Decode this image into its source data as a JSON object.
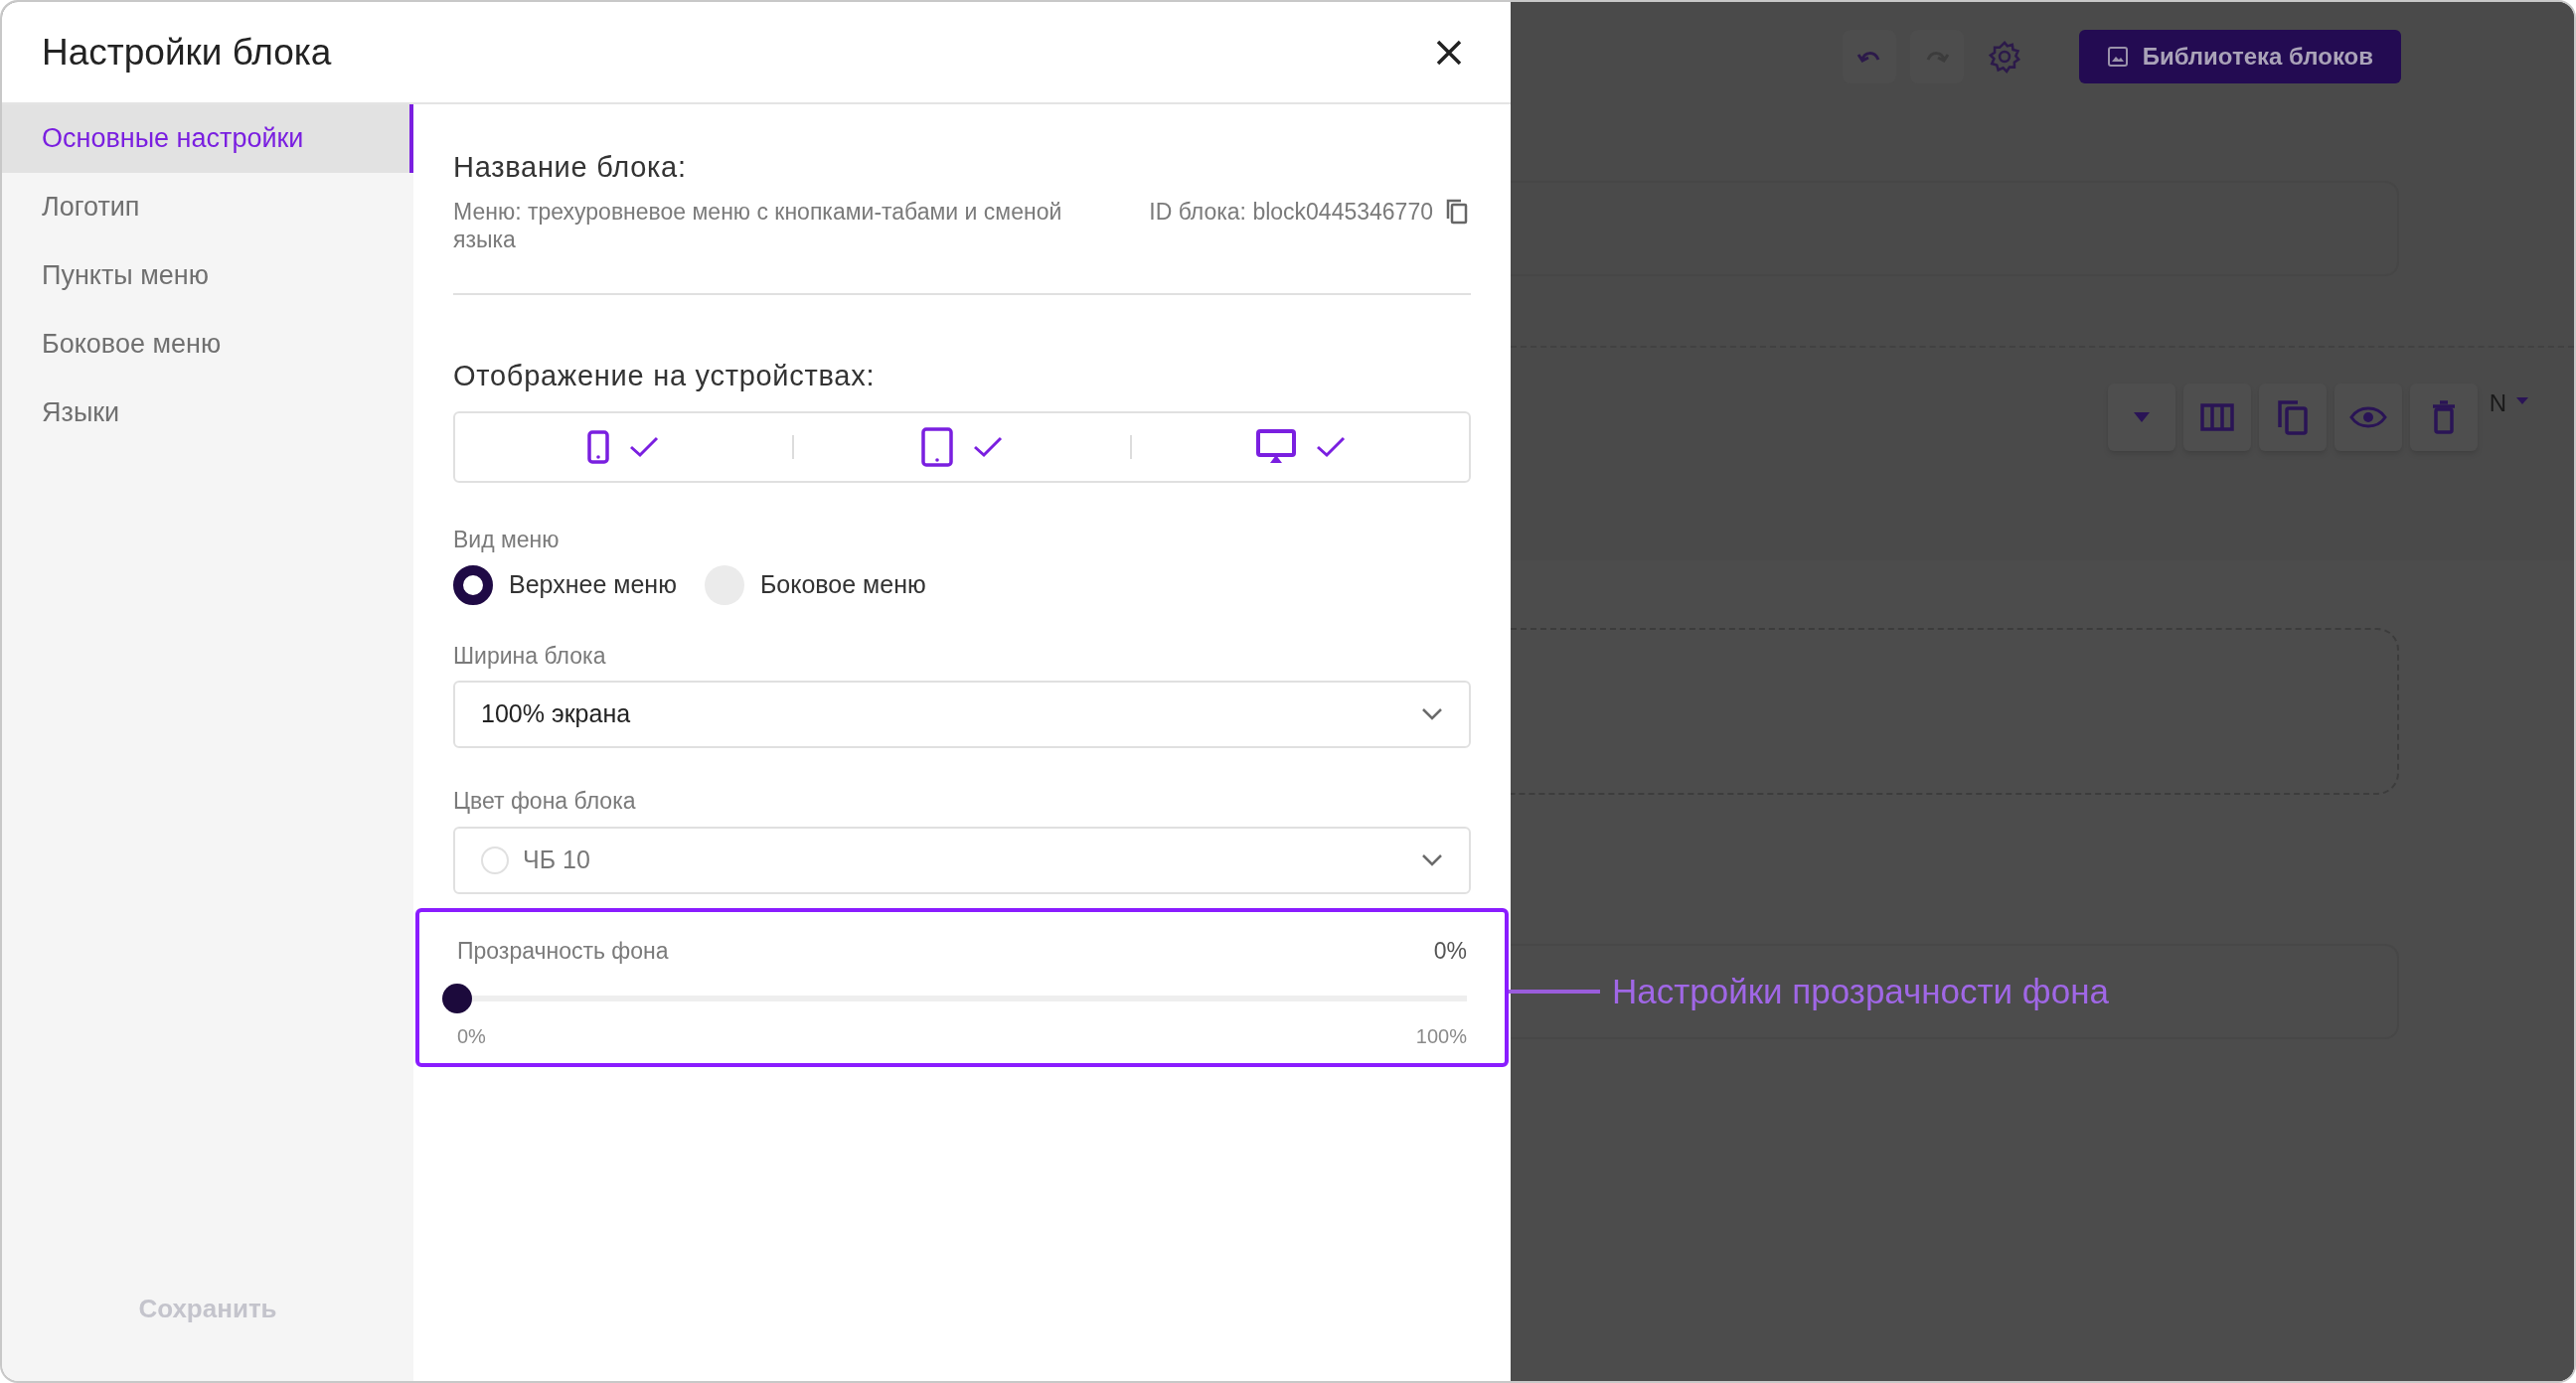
{
  "dialog": {
    "title": "Настройки блока",
    "sidebar": {
      "items": [
        {
          "label": "Основные настройки",
          "selected": true
        },
        {
          "label": "Логотип",
          "selected": false
        },
        {
          "label": "Пункты меню",
          "selected": false
        },
        {
          "label": "Боковое меню",
          "selected": false
        },
        {
          "label": "Языки",
          "selected": false
        }
      ],
      "save_button": {
        "label": "Сохранить",
        "disabled": true
      }
    },
    "block_name": {
      "heading": "Название блока:",
      "description": "Меню: трехуровневое меню с кнопками-табами и сменой языка",
      "id_text": "ID блока: block0445346770"
    },
    "devices": {
      "heading": "Отображение на устройствах:",
      "items": [
        {
          "kind": "phone",
          "checked": true
        },
        {
          "kind": "tablet",
          "checked": true
        },
        {
          "kind": "desktop",
          "checked": true
        }
      ]
    },
    "menu_type": {
      "label": "Вид меню",
      "options": [
        {
          "label": "Верхнее меню",
          "selected": true
        },
        {
          "label": "Боковое меню",
          "selected": false
        }
      ]
    },
    "block_width": {
      "label": "Ширина блока",
      "value": "100% экрана"
    },
    "background_color": {
      "label": "Цвет фона блока",
      "value": "ЧБ 10"
    },
    "transparency": {
      "label": "Прозрачность фона",
      "reading": "0%",
      "level": 0,
      "min_label": "0%",
      "max_label": "100%",
      "highlighted": true
    }
  },
  "annotation": {
    "text": "Настройки прозрачности фона"
  },
  "editor": {
    "library_button": "Библиотека блоков",
    "language_label": "N"
  }
}
